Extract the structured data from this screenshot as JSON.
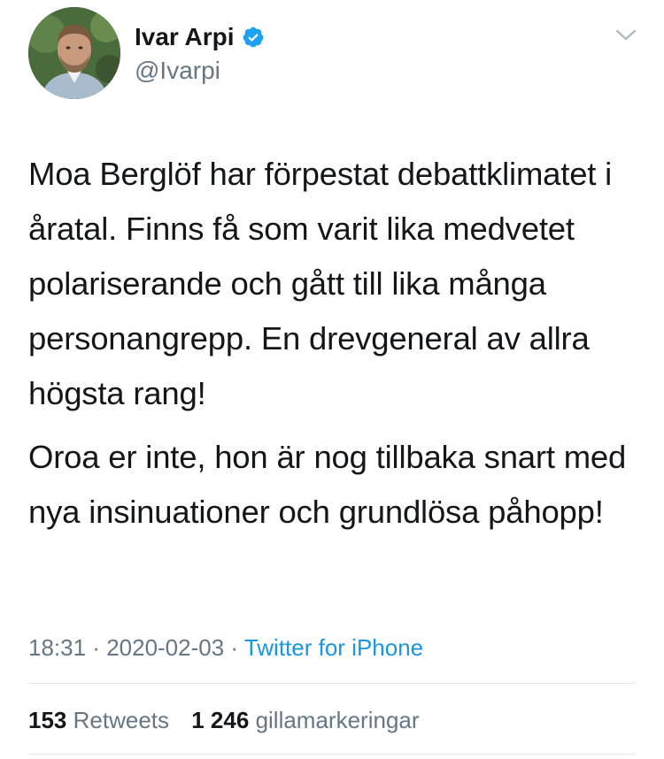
{
  "author": {
    "display_name": "Ivar Arpi",
    "handle": "@Ivarpi",
    "verified": true
  },
  "icons": {
    "verified": "verified-badge-icon",
    "more": "chevron-down-icon"
  },
  "tweet": {
    "paragraphs": [
      "Moa Berglöf har förpestat debattklimatet i åratal. Finns få som varit lika medvetet polariserande och gått till lika många personangrepp. En drevgeneral av allra högsta rang!",
      "Oroa er inte, hon är nog tillbaka snart med nya insinuationer och grundlösa påhopp!"
    ],
    "time": "18:31",
    "separator": " · ",
    "date": "2020-02-03",
    "source": "Twitter for iPhone"
  },
  "stats": {
    "retweets_count": "153",
    "retweets_label": "Retweets",
    "likes_count": "1 246",
    "likes_label": "gillamarkeringar"
  },
  "colors": {
    "text": "#14171a",
    "secondary": "#657786",
    "accent": "#1b95e0",
    "verified": "#1da1f2",
    "divider": "#e1e8ed"
  }
}
